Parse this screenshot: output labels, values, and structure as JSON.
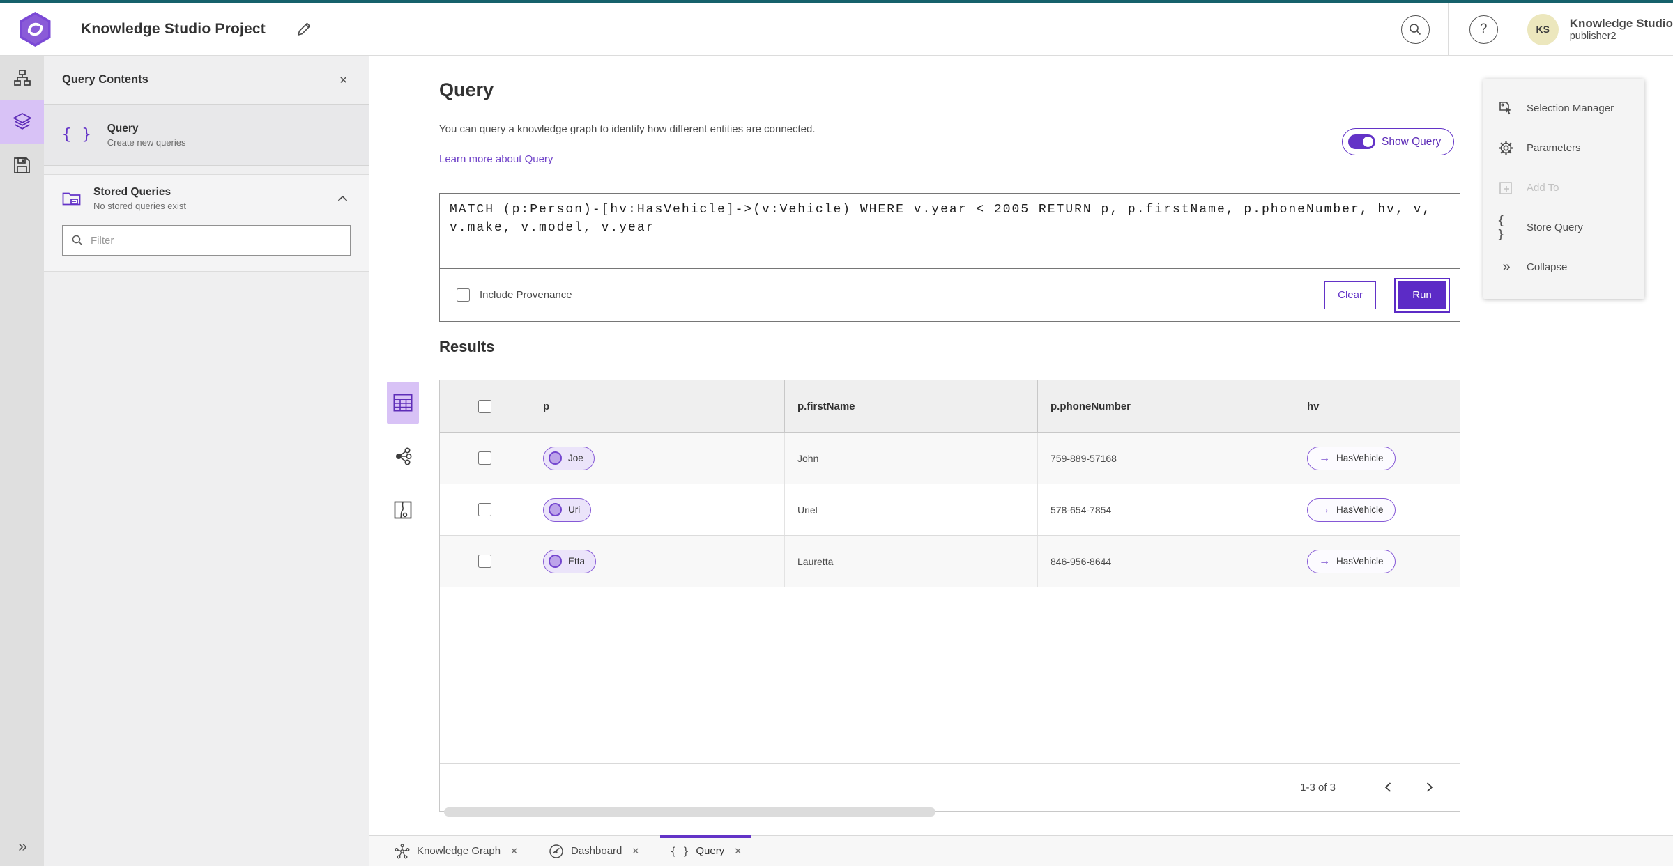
{
  "header": {
    "app_title": "Knowledge Studio Project",
    "user_initials": "KS",
    "user_org": "Knowledge Studio",
    "user_name": "publisher2"
  },
  "sidebar": {
    "title": "Query Contents",
    "query_item": {
      "title": "Query",
      "subtitle": "Create new queries"
    },
    "stored_queries": {
      "title": "Stored Queries",
      "subtitle": "No stored queries exist"
    },
    "filter_placeholder": "Filter"
  },
  "main": {
    "title": "Query",
    "description": "You can query a knowledge graph to identify how different entities are connected.",
    "learn_more": "Learn more about Query",
    "show_query_label": "Show Query",
    "query_text": "MATCH (p:Person)-[hv:HasVehicle]->(v:Vehicle) WHERE v.year < 2005 RETURN p, p.firstName, p.phoneNumber, hv, v, v.make, v.model, v.year",
    "include_provenance_label": "Include Provenance",
    "clear_label": "Clear",
    "run_label": "Run",
    "results_title": "Results"
  },
  "table": {
    "columns": [
      "p",
      "p.firstName",
      "p.phoneNumber",
      "hv"
    ],
    "rows": [
      {
        "p": "Joe",
        "firstName": "John",
        "phoneNumber": "759-889-57168",
        "hv": "HasVehicle"
      },
      {
        "p": "Uri",
        "firstName": "Uriel",
        "phoneNumber": "578-654-7854",
        "hv": "HasVehicle"
      },
      {
        "p": "Etta",
        "firstName": "Lauretta",
        "phoneNumber": "846-956-8644",
        "hv": "HasVehicle"
      }
    ],
    "pagination": "1-3 of 3"
  },
  "context_menu": {
    "items": [
      {
        "label": "Selection Manager"
      },
      {
        "label": "Parameters"
      },
      {
        "label": "Add To"
      },
      {
        "label": "Store Query"
      },
      {
        "label": "Collapse"
      }
    ]
  },
  "tabs": [
    {
      "label": "Knowledge Graph"
    },
    {
      "label": "Dashboard"
    },
    {
      "label": "Query"
    }
  ],
  "icons": {
    "braces": "{ }",
    "close": "✕",
    "help": "?",
    "arrow_right": "→",
    "double_chevron": "»"
  },
  "colors": {
    "accent_purple": "#6333c7",
    "accent_light": "#d8c2f6",
    "top_strip_teal": "#16616b",
    "run_button": "#5c2bc6",
    "avatar_bg": "#ece7bd"
  }
}
